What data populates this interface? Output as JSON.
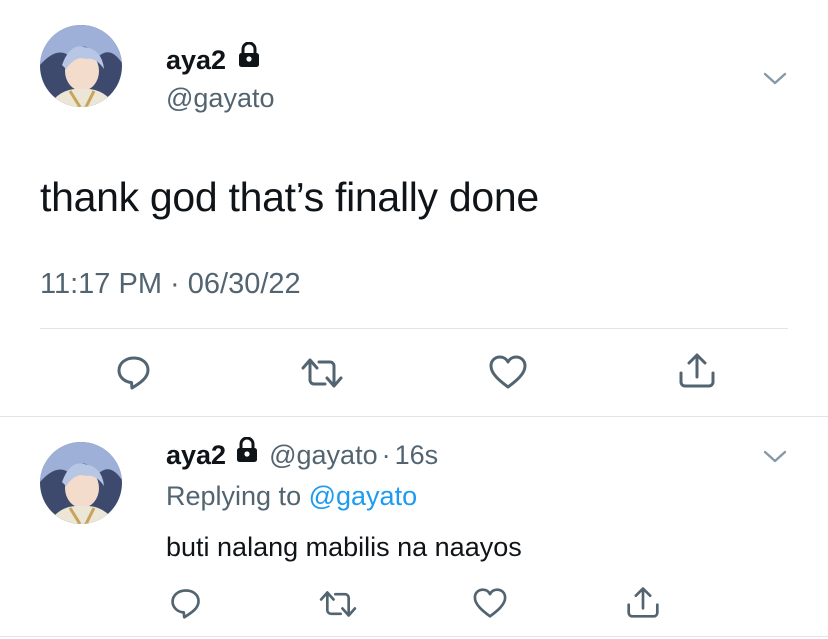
{
  "main_tweet": {
    "display_name": "aya2",
    "handle": "@gayato",
    "text": "thank god that’s finally done",
    "time": "11:17 PM",
    "separator": "·",
    "date": "06/30/22",
    "icons": {
      "lock": "lock-icon",
      "menu": "chevron-down-icon",
      "reply": "reply-icon",
      "retweet": "retweet-icon",
      "like": "heart-icon",
      "share": "share-icon"
    }
  },
  "reply_tweet": {
    "display_name": "aya2",
    "handle": "@gayato",
    "separator": "·",
    "age": "16s",
    "replying_to_label": "Replying to",
    "replying_to_handle": "@gayato",
    "text": "buti nalang mabilis na naayos"
  },
  "colors": {
    "text": "#0f1419",
    "muted": "#536471",
    "link": "#1d9bf0",
    "icon": "#536471",
    "divider": "#e1e4e8"
  }
}
